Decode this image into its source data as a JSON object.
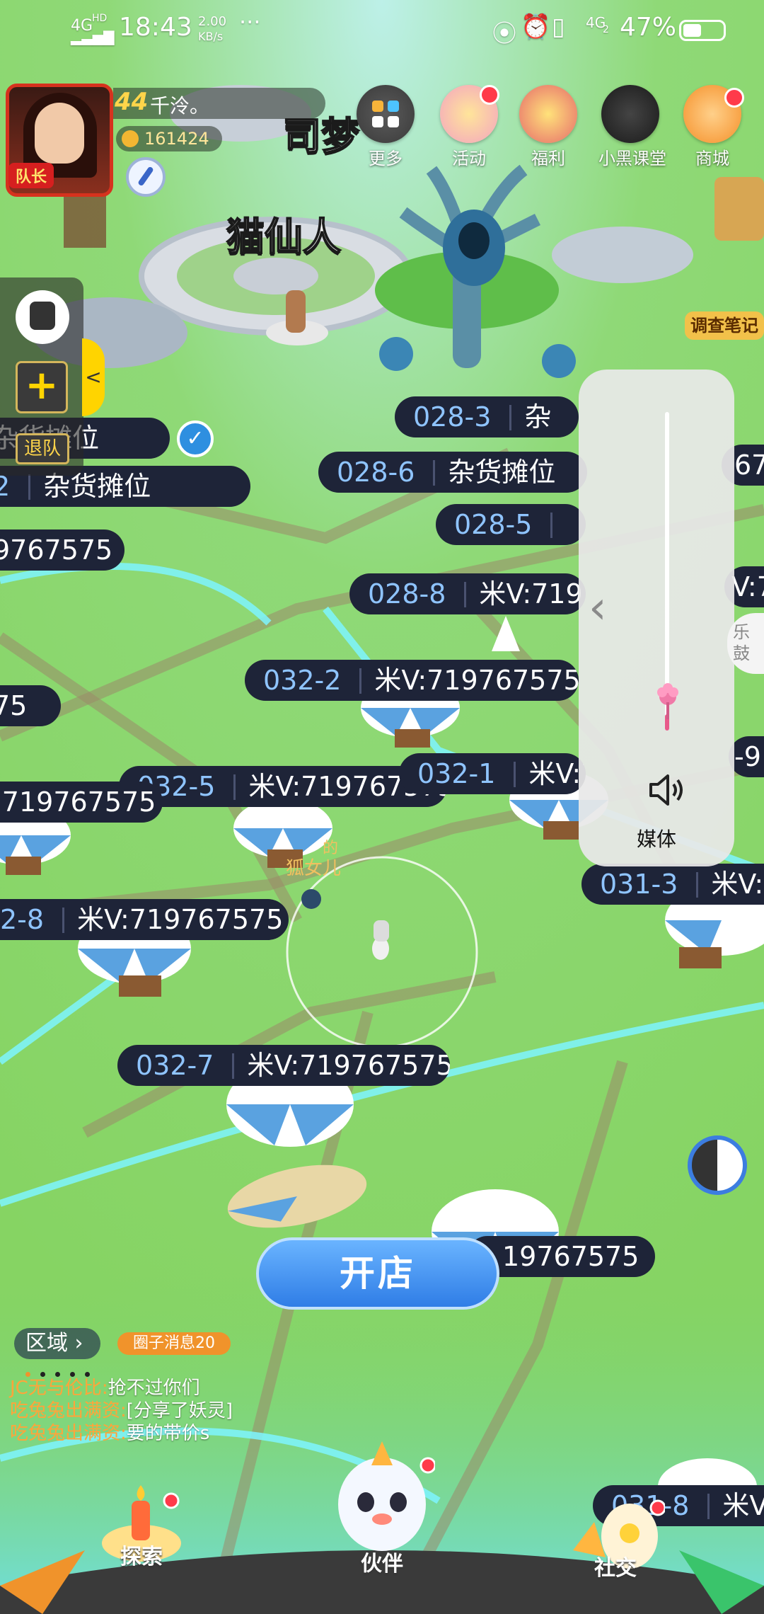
{
  "status_bar": {
    "network": "4G",
    "network_sup": "HD",
    "time": "18:43",
    "speed_value": "2.00",
    "speed_unit": "KB/s",
    "more": "···",
    "network2": "4G",
    "network2_sub": "2",
    "battery": "47%",
    "battery_level": 0.47
  },
  "player": {
    "level": "44",
    "name": "千泠。",
    "coins": "161424",
    "role_badge": "队长"
  },
  "top_menu": [
    {
      "label": "更多",
      "icon": "grid-icon",
      "dot": false
    },
    {
      "label": "活动",
      "icon": "cake-icon",
      "dot": true
    },
    {
      "label": "福利",
      "icon": "gift-icon",
      "dot": false
    },
    {
      "label": "小黑课堂",
      "icon": "black-cat-icon",
      "dot": false
    },
    {
      "label": "商城",
      "icon": "shop-icon",
      "dot": true
    }
  ],
  "map_labels": {
    "sima": "司梦",
    "maoxianren": "猫仙人",
    "notebook": "调查笔记",
    "drum": "乐鼓",
    "npc_name": "狐女儿",
    "npc_name_prefix": "的"
  },
  "left_panel": {
    "plus": "+",
    "quit": "退队",
    "collapse": "<"
  },
  "stalls": [
    {
      "id": "",
      "text": "杂货摊位",
      "prefix": "杂"
    },
    {
      "id": "028-3",
      "text": "杂"
    },
    {
      "id": "2",
      "text": "杂货摊位"
    },
    {
      "id": "028-6",
      "text": "杂货摊位"
    },
    {
      "id": "",
      "text": "67"
    },
    {
      "id": "028-5",
      "text": ""
    },
    {
      "id": "",
      "text": "9767575"
    },
    {
      "id": "028-8",
      "text": "米V:7197"
    },
    {
      "id": "",
      "text": "V:7"
    },
    {
      "id": "032-2",
      "text": "米V:719767575"
    },
    {
      "id": "",
      "text": "75"
    },
    {
      "id": "032-5",
      "text": "米V:719767575"
    },
    {
      "id": "032-1",
      "text": "米V:7"
    },
    {
      "id": "",
      "text": ":719767575"
    },
    {
      "id": "",
      "text": "-9"
    },
    {
      "id": "031-3",
      "text": "米V:7"
    },
    {
      "id": "2-8",
      "text": "米V:719767575"
    },
    {
      "id": "032-7",
      "text": "米V:719767575"
    },
    {
      "id": "",
      "text": "19767575"
    },
    {
      "id": "031-8",
      "text": "米V:"
    }
  ],
  "volume": {
    "label": "媒体",
    "level": 0.05
  },
  "action": {
    "open_shop": "开店"
  },
  "chat": {
    "region": "区域",
    "circle_msg": "圈子消息20",
    "messages": [
      {
        "user": "JC无与伦比:",
        "text": "抢不过你们"
      },
      {
        "user": "吃兔兔出满资:",
        "text": "[分享了妖灵]"
      },
      {
        "user": "吃兔兔出满资:",
        "text": "要的带价s"
      }
    ]
  },
  "bottom_nav": [
    {
      "label": "探索"
    },
    {
      "label": "伙伴"
    },
    {
      "label": "社交"
    }
  ]
}
